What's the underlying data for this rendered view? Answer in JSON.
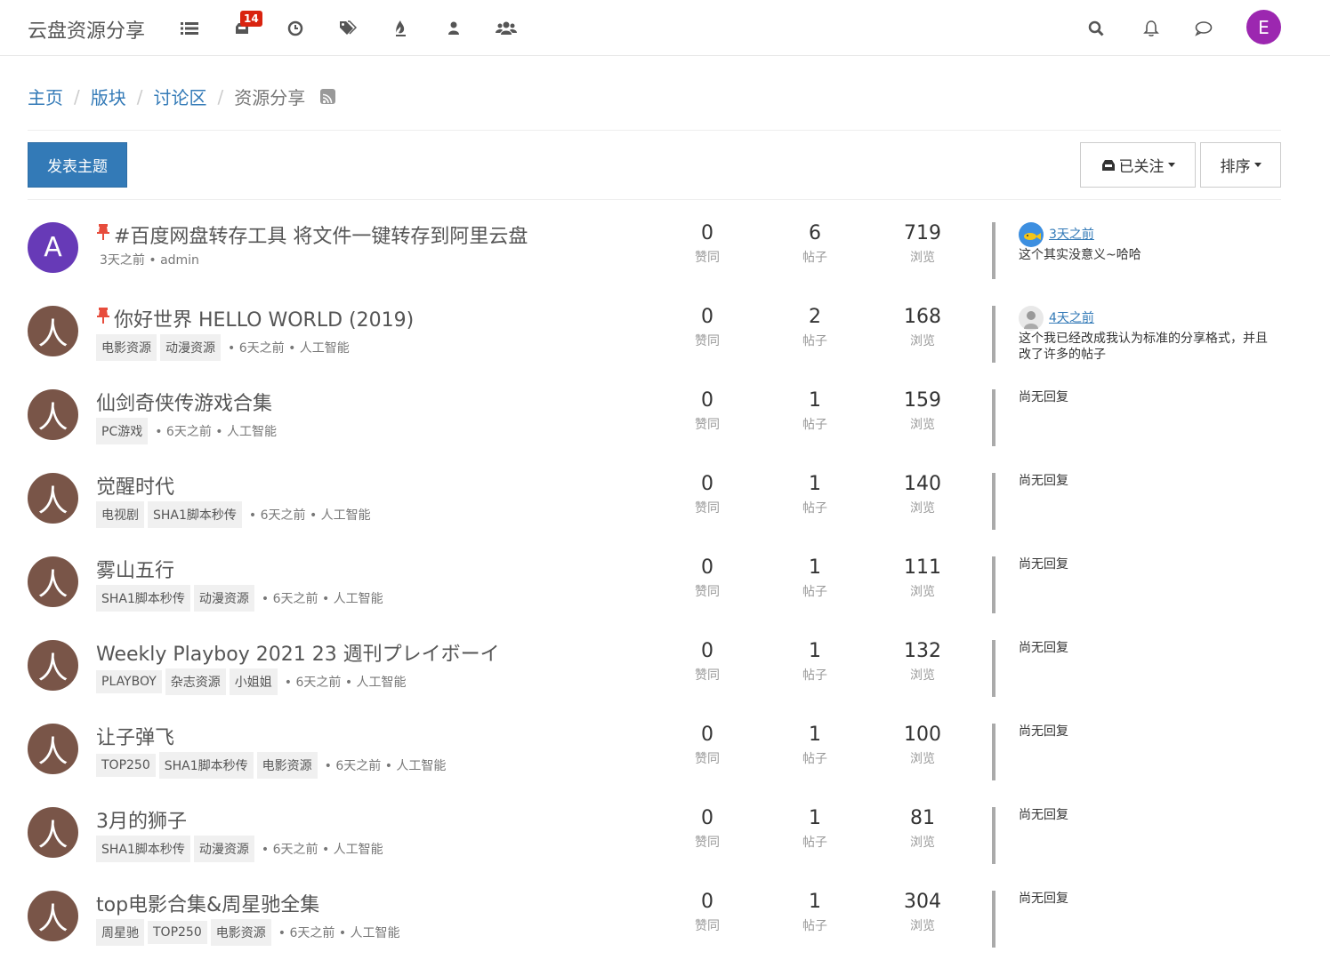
{
  "brand": "云盘资源分享",
  "nav": {
    "unread_badge": "14"
  },
  "user_initial": "E",
  "breadcrumb": {
    "home": "主页",
    "categories": "版块",
    "discussion": "讨论区",
    "current": "资源分享"
  },
  "toolbar": {
    "post_label": "发表主题",
    "watch_label": "已关注",
    "sort_label": "排序"
  },
  "stat_labels": {
    "votes": "赞同",
    "posts": "帖子",
    "views": "浏览"
  },
  "topics": [
    {
      "title": "#百度网盘转存工具 将文件一键转存到阿里云盘",
      "pinned": true,
      "avatar": "A",
      "avatar_color": "#673ab7",
      "tags": [],
      "meta": "3天之前 • admin",
      "votes": "0",
      "posts": "6",
      "views": "719",
      "teaser_time": "3天之前",
      "teaser_text": "这个其实没意义~哈哈",
      "teaser_avatar": "fish"
    },
    {
      "title": "你好世界 HELLO WORLD (2019)",
      "pinned": true,
      "avatar": "人",
      "avatar_color": "#795548",
      "tags": [
        "电影资源",
        "动漫资源"
      ],
      "meta": "• 6天之前 • 人工智能",
      "votes": "0",
      "posts": "2",
      "views": "168",
      "teaser_time": "4天之前",
      "teaser_text": "这个我已经改成我认为标准的分享格式，并且改了许多的帖子",
      "teaser_avatar": "portrait"
    },
    {
      "title": "仙剑奇侠传游戏合集",
      "pinned": false,
      "avatar": "人",
      "avatar_color": "#795548",
      "tags": [
        "PC游戏"
      ],
      "meta": "• 6天之前 • 人工智能",
      "votes": "0",
      "posts": "1",
      "views": "159",
      "no_reply": "尚无回复"
    },
    {
      "title": "觉醒时代",
      "pinned": false,
      "avatar": "人",
      "avatar_color": "#795548",
      "tags": [
        "电视剧",
        "SHA1脚本秒传"
      ],
      "meta": "• 6天之前 • 人工智能",
      "votes": "0",
      "posts": "1",
      "views": "140",
      "no_reply": "尚无回复"
    },
    {
      "title": "雾山五行",
      "pinned": false,
      "avatar": "人",
      "avatar_color": "#795548",
      "tags": [
        "SHA1脚本秒传",
        "动漫资源"
      ],
      "meta": "• 6天之前 • 人工智能",
      "votes": "0",
      "posts": "1",
      "views": "111",
      "no_reply": "尚无回复"
    },
    {
      "title": "Weekly Playboy 2021 23 週刊プレイボーイ",
      "pinned": false,
      "avatar": "人",
      "avatar_color": "#795548",
      "tags": [
        "PLAYBOY",
        "杂志资源",
        "小姐姐"
      ],
      "meta": "• 6天之前 • 人工智能",
      "votes": "0",
      "posts": "1",
      "views": "132",
      "no_reply": "尚无回复"
    },
    {
      "title": "让子弹飞",
      "pinned": false,
      "avatar": "人",
      "avatar_color": "#795548",
      "tags": [
        "TOP250",
        "SHA1脚本秒传",
        "电影资源"
      ],
      "meta": "• 6天之前 • 人工智能",
      "votes": "0",
      "posts": "1",
      "views": "100",
      "no_reply": "尚无回复"
    },
    {
      "title": "3月的狮子",
      "pinned": false,
      "avatar": "人",
      "avatar_color": "#795548",
      "tags": [
        "SHA1脚本秒传",
        "动漫资源"
      ],
      "meta": "• 6天之前 • 人工智能",
      "votes": "0",
      "posts": "1",
      "views": "81",
      "no_reply": "尚无回复"
    },
    {
      "title": "top电影合集&周星驰全集",
      "pinned": false,
      "avatar": "人",
      "avatar_color": "#795548",
      "tags": [
        "周星驰",
        "TOP250",
        "电影资源"
      ],
      "meta": "• 6天之前 • 人工智能",
      "votes": "0",
      "posts": "1",
      "views": "304",
      "no_reply": "尚无回复"
    }
  ]
}
